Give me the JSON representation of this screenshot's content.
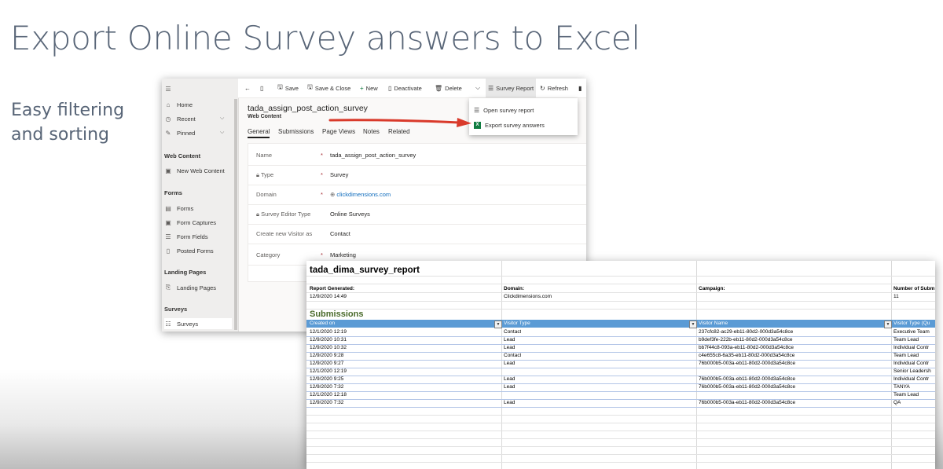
{
  "slide": {
    "title": "Export Online Survey answers to Excel",
    "subtitle": "Easy filtering and sorting"
  },
  "crm": {
    "sidebar": {
      "top_items": [
        {
          "label": "Home",
          "icon": "home-icon"
        },
        {
          "label": "Recent",
          "icon": "clock-icon"
        },
        {
          "label": "Pinned",
          "icon": "pin-icon"
        }
      ],
      "sections": [
        {
          "title": "Web Content",
          "items": [
            {
              "label": "New Web Content",
              "icon": "web-icon"
            }
          ]
        },
        {
          "title": "Forms",
          "items": [
            {
              "label": "Forms",
              "icon": "form-icon"
            },
            {
              "label": "Form Captures",
              "icon": "capture-icon"
            },
            {
              "label": "Form Fields",
              "icon": "list-icon"
            },
            {
              "label": "Posted Forms",
              "icon": "document-icon"
            }
          ]
        },
        {
          "title": "Landing Pages",
          "items": [
            {
              "label": "Landing Pages",
              "icon": "page-icon"
            }
          ]
        },
        {
          "title": "Surveys",
          "items": [
            {
              "label": "Surveys",
              "icon": "survey-icon"
            }
          ]
        }
      ]
    },
    "toolbar": {
      "save": "Save",
      "save_close": "Save & Close",
      "new": "New",
      "deactivate": "Deactivate",
      "delete": "Delete",
      "survey_report": "Survey Report",
      "refresh": "Refresh"
    },
    "dropdown": {
      "open_report": "Open survey report",
      "export_answers": "Export survey answers"
    },
    "record": {
      "title": "tada_assign_post_action_survey",
      "entity": "Web Content"
    },
    "tabs": [
      "General",
      "Submissions",
      "Page Views",
      "Notes",
      "Related"
    ],
    "fields": [
      {
        "label": "Name",
        "required": "*",
        "value": "tada_assign_post_action_survey"
      },
      {
        "label": "Type",
        "required": "*",
        "value": "Survey"
      },
      {
        "label": "Domain",
        "required": "*",
        "value": "clickdimensions.com"
      },
      {
        "label": "Survey Editor Type",
        "required": "",
        "value": "Online Surveys"
      },
      {
        "label": "Create new Visitor as",
        "required": "",
        "value": "Contact"
      },
      {
        "label": "Category",
        "required": "*",
        "value": "Marketing"
      }
    ]
  },
  "sheet": {
    "title": "tada_dima_survey_report",
    "meta_headers": [
      "Report Generated:",
      "Domain:",
      "Campaign:",
      "Number of Subm"
    ],
    "meta_values": [
      "12/9/2020 14:49",
      "Clickdimensions.com",
      "",
      "11"
    ],
    "section": "Submissions",
    "columns": [
      "Created on",
      "Visitor Type",
      "Visitor Name",
      "Visitor Type (Qu"
    ],
    "rows": [
      [
        "12/1/2020 12:19",
        "Contact",
        "237cfc82-ac29-eb11-80d2-000d3a54c8ce",
        "Executive Team"
      ],
      [
        "12/9/2020 10:31",
        "Lead",
        "b9def3fe-222b-eb11-80d2-000d3a54c8ce",
        "Team Lead"
      ],
      [
        "12/9/2020 10:32",
        "Lead",
        "bb7f44c8-093a-eb11-80d2-000d3a54c8ce",
        "Individual Contr"
      ],
      [
        "12/9/2020 9:28",
        "Contact",
        "c4e655c8-6a35-eb11-80d2-000d3a54c8ce",
        "Team Lead"
      ],
      [
        "12/9/2020 9:27",
        "Lead",
        "76b000b5-003a-eb11-80d2-000d3a54c8ce",
        "Individual Contr"
      ],
      [
        "12/1/2020 12:19",
        "",
        "",
        "Senior Leadersh"
      ],
      [
        "12/9/2020 9:25",
        "Lead",
        "76b000b5-003a-eb11-80d2-000d3a54c8ce",
        "Individual Contr"
      ],
      [
        "12/9/2020 7:32",
        "Lead",
        "76b000b5-003a-eb11-80d2-000d3a54c8ce",
        "TANYA"
      ],
      [
        "12/1/2020 12:18",
        "",
        "",
        "Team Lead"
      ],
      [
        "12/9/2020 7:32",
        "Lead",
        "76b000b5-003a-eb11-80d2-000d3a54c8ce",
        "QA"
      ]
    ]
  },
  "colors": {
    "title_text": "#586577",
    "excel_header": "#5b9bd5",
    "submissions_green": "#4a6b2b",
    "arrow_red": "#d93a2b",
    "link_blue": "#0f6cbd"
  }
}
